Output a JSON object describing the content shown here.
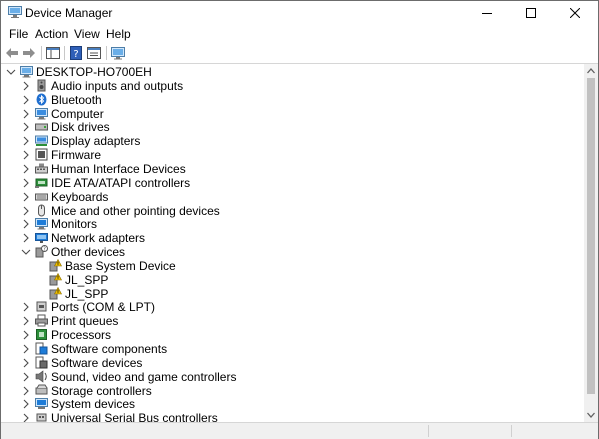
{
  "window": {
    "title": "Device Manager"
  },
  "menu": [
    "File",
    "Action",
    "View",
    "Help"
  ],
  "tree": {
    "root": "DESKTOP-HO700EH",
    "items": [
      {
        "label": "Audio inputs and outputs",
        "icon": "speaker-icon",
        "expanded": false
      },
      {
        "label": "Bluetooth",
        "icon": "bluetooth-icon",
        "expanded": false
      },
      {
        "label": "Computer",
        "icon": "computer-icon",
        "expanded": false
      },
      {
        "label": "Disk drives",
        "icon": "disk-drive-icon",
        "expanded": false
      },
      {
        "label": "Display adapters",
        "icon": "display-adapter-icon",
        "expanded": false
      },
      {
        "label": "Firmware",
        "icon": "firmware-icon",
        "expanded": false
      },
      {
        "label": "Human Interface Devices",
        "icon": "hid-icon",
        "expanded": false
      },
      {
        "label": "IDE ATA/ATAPI controllers",
        "icon": "ide-controller-icon",
        "expanded": false
      },
      {
        "label": "Keyboards",
        "icon": "keyboard-icon",
        "expanded": false
      },
      {
        "label": "Mice and other pointing devices",
        "icon": "mouse-icon",
        "expanded": false
      },
      {
        "label": "Monitors",
        "icon": "monitor-icon",
        "expanded": false
      },
      {
        "label": "Network adapters",
        "icon": "network-adapter-icon",
        "expanded": false
      },
      {
        "label": "Other devices",
        "icon": "unknown-device-icon",
        "expanded": true,
        "children": [
          {
            "label": "Base System Device",
            "icon": "warning-device-icon"
          },
          {
            "label": "JL_SPP",
            "icon": "warning-device-icon"
          },
          {
            "label": "JL_SPP",
            "icon": "warning-device-icon"
          }
        ]
      },
      {
        "label": "Ports (COM & LPT)",
        "icon": "port-icon",
        "expanded": false
      },
      {
        "label": "Print queues",
        "icon": "printer-icon",
        "expanded": false
      },
      {
        "label": "Processors",
        "icon": "processor-icon",
        "expanded": false
      },
      {
        "label": "Software components",
        "icon": "software-component-icon",
        "expanded": false
      },
      {
        "label": "Software devices",
        "icon": "software-device-icon",
        "expanded": false
      },
      {
        "label": "Sound, video and game controllers",
        "icon": "sound-controller-icon",
        "expanded": false
      },
      {
        "label": "Storage controllers",
        "icon": "storage-controller-icon",
        "expanded": false
      },
      {
        "label": "System devices",
        "icon": "system-device-icon",
        "expanded": false
      },
      {
        "label": "Universal Serial Bus controllers",
        "icon": "usb-icon",
        "expanded": false
      }
    ]
  },
  "colors": {
    "accent": "#1e7cd8",
    "warning": "#f2c200"
  }
}
